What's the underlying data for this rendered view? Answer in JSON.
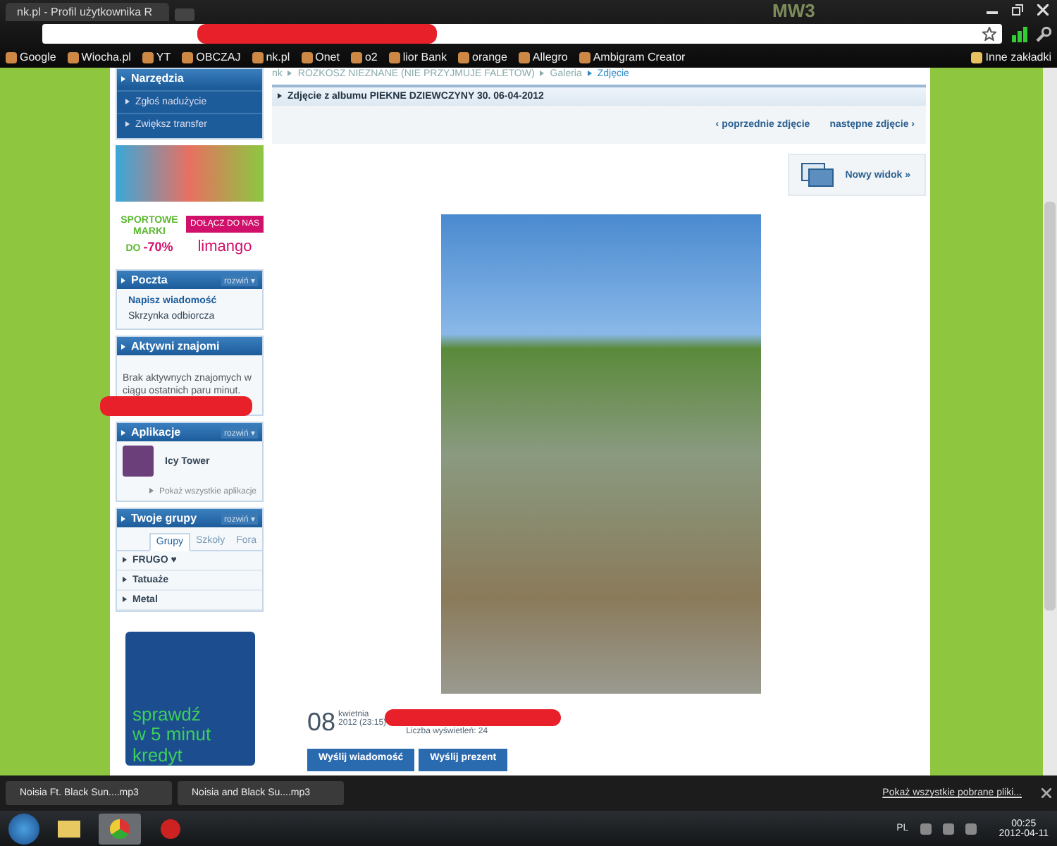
{
  "browser": {
    "tab_title": "nk.pl - Profil użytkownika R",
    "theme_logo": "MW3",
    "bookmarks": [
      "Google",
      "Wiocha.pl",
      "YT",
      "OBCZAJ",
      "nk.pl",
      "Onet",
      "o2",
      "lior Bank",
      "orange",
      "Allegro",
      "Ambigram Creator"
    ],
    "other_bookmarks": "Inne zakładki"
  },
  "sidebar": {
    "tools": {
      "title": "Narzędzia",
      "links": [
        "Zgłoś nadużycie",
        "Zwiększ transfer"
      ]
    },
    "ad": {
      "lines": [
        "SPORTOWE",
        "MARKI",
        "DO"
      ],
      "discount": "-70%",
      "button": "DOŁĄCZ DO NAS",
      "brand": "limango"
    },
    "mail": {
      "title": "Poczta",
      "expand": "rozwiń ▾",
      "links": [
        "Napisz wiadomość",
        "Skrzynka odbiorcza"
      ]
    },
    "friends": {
      "title": "Aktywni znajomi",
      "message": "Brak aktywnych znajomych w ciągu ostatnich paru minut."
    },
    "apps": {
      "title": "Aplikacje",
      "expand": "rozwiń ▾",
      "items": [
        "Icy Tower"
      ],
      "show_all": "Pokaż wszystkie aplikacje"
    },
    "groups": {
      "title": "Twoje grupy",
      "expand": "rozwiń ▾",
      "tabs": [
        {
          "label": "Grupy",
          "selected": true
        },
        {
          "label": "Szkoły",
          "selected": false
        },
        {
          "label": "Fora",
          "selected": false
        }
      ],
      "items": [
        "FRUGO ♥",
        "Tatuaże",
        "Metal"
      ]
    },
    "loan_ad": [
      "sprawdź",
      "w 5 minut",
      "kredyt"
    ]
  },
  "main": {
    "breadcrumb": [
      "nk",
      "ROZKOSZ NIEZNANE (NIE PRZYJMUJE FALETOW)",
      "Galeria",
      "Zdjęcie"
    ],
    "album_title": "Zdjęcie z albumu PIEKNE DZIEWCZYNY 30. 06-04-2012",
    "prev": "‹ poprzednie zdjęcie",
    "next": "następne zdjęcie ›",
    "new_view": "Nowy widok »",
    "day": "08",
    "month": "kwietnia",
    "time": "2012 (23:15)",
    "views": "Liczba wyświetleń: 24",
    "buttons": [
      "Wyślij wiadomość",
      "Wyślij prezent"
    ]
  },
  "downloads": {
    "items": [
      "Noisia Ft. Black Sun....mp3",
      "Noisia and Black Su....mp3"
    ],
    "show_all": "Pokaż wszystkie pobrane pliki..."
  },
  "taskbar": {
    "language": "PL",
    "time": "00:25",
    "date": "2012-04-11"
  }
}
